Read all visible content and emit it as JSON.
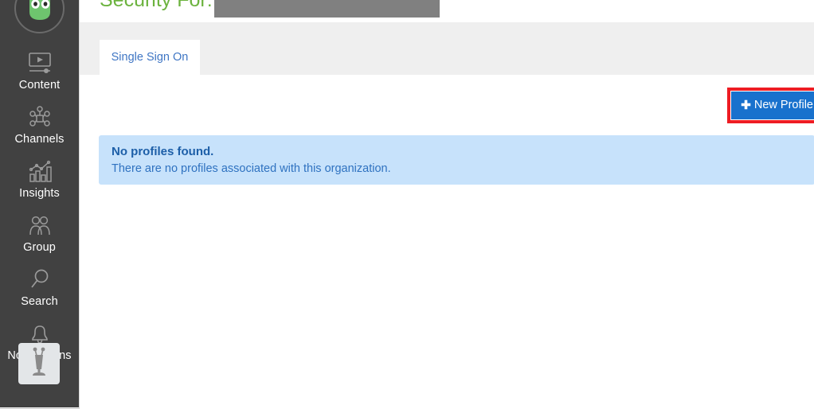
{
  "sidebar": {
    "avatar": {
      "icon": "android-avatar-icon",
      "colors": {
        "head": "#6ec46e",
        "ring": "#6a6a6a"
      }
    },
    "items": [
      {
        "label": "Content",
        "icon": "video-player-icon"
      },
      {
        "label": "Channels",
        "icon": "network-nodes-icon"
      },
      {
        "label": "Insights",
        "icon": "bar-chart-trend-icon"
      },
      {
        "label": "Group",
        "icon": "people-group-icon"
      },
      {
        "label": "Search",
        "icon": "magnifier-icon"
      },
      {
        "label": "Notifications",
        "icon": "bell-icon"
      }
    ],
    "bot_tile": {
      "icon": "robot-antenna-icon"
    },
    "background": "#414141"
  },
  "header": {
    "title": "Security For:",
    "title_color": "#6cb33f",
    "redacted_value": "",
    "redaction_color": "#808080"
  },
  "tabs": [
    {
      "label": "Single Sign On",
      "active": true
    }
  ],
  "toolbar": {
    "new_profile_label": "New Profile",
    "plus_icon": "plus-icon",
    "button_color": "#1871cd",
    "highlight_color": "#ee1c23"
  },
  "alert": {
    "title": "No profiles found.",
    "message": "There are no profiles associated with this organization.",
    "background": "#c7e2fb",
    "title_color": "#1d5fa8",
    "text_color": "#2f72c0"
  }
}
